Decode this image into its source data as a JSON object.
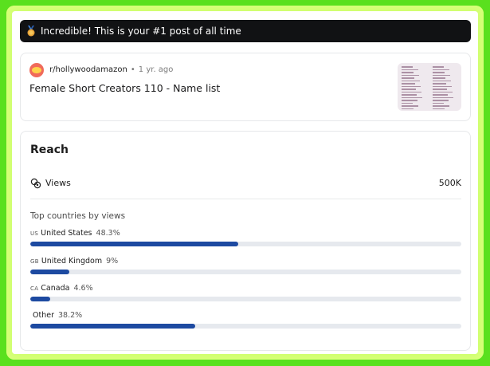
{
  "banner": {
    "icon": "medal-icon",
    "text": "Incredible! This is your #1 post of all time"
  },
  "post": {
    "subreddit": "r/hollywoodamazon",
    "separator": "•",
    "age": "1 yr. ago",
    "title": "Female Short Creators 110 - Name list",
    "thumbnail": "name-list-thumbnail"
  },
  "reach": {
    "title": "Reach",
    "views_label": "Views",
    "views_value": "500K",
    "countries_heading": "Top countries by views",
    "countries": [
      {
        "code": "US",
        "name": "United States",
        "percent_label": "48.3%",
        "percent": 48.3
      },
      {
        "code": "GB",
        "name": "United Kingdom",
        "percent_label": "9%",
        "percent": 9
      },
      {
        "code": "CA",
        "name": "Canada",
        "percent_label": "4.6%",
        "percent": 4.6
      },
      {
        "code": "",
        "name": "Other",
        "percent_label": "38.2%",
        "percent": 38.2
      }
    ]
  },
  "colors": {
    "bar_fill": "#1d4aa1",
    "bar_track": "#e6e9ee",
    "banner_bg": "#111214",
    "frame_glow": "#5ae01e"
  }
}
